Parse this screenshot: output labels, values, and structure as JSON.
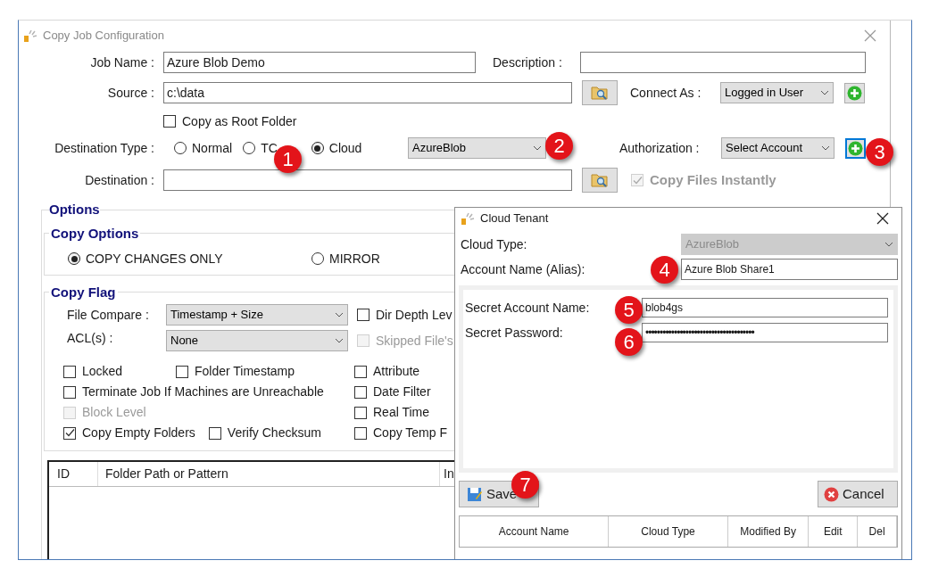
{
  "window": {
    "title": "Copy Job Configuration"
  },
  "job_name": {
    "label": "Job Name :",
    "value": "Azure Blob Demo"
  },
  "description": {
    "label": "Description :"
  },
  "source": {
    "label": "Source :",
    "value": "c:\\data"
  },
  "connect_as": {
    "label": "Connect As :",
    "value": "Logged in User",
    "add_focused": false
  },
  "copy_as_root_folder": {
    "label": "Copy as Root Folder",
    "checked": false,
    "disabled": false
  },
  "destination_type": {
    "label": "Destination Type :",
    "options": [
      {
        "label": "Normal",
        "selected": false
      },
      {
        "label": "TC",
        "selected": false
      },
      {
        "label": "Cloud",
        "selected": true
      }
    ]
  },
  "cloud_provider": {
    "value": "AzureBlob"
  },
  "authorization": {
    "label": "Authorization :",
    "value": "Select Account",
    "add_focused": true
  },
  "destination": {
    "label": "Destination :"
  },
  "copy_files_instantly": {
    "label": "Copy Files Instantly",
    "checked": true,
    "disabled": true
  },
  "options": {
    "title": "Options",
    "copy_options": {
      "title": "Copy Options",
      "choices": [
        {
          "label": "COPY CHANGES ONLY",
          "selected": true
        },
        {
          "label": "MIRROR",
          "selected": false
        }
      ]
    },
    "copy_flag": {
      "title": "Copy Flag",
      "file_compare": {
        "label": "File Compare :",
        "value": "Timestamp + Size"
      },
      "acl": {
        "label": "ACL(s) :",
        "value": "None"
      },
      "side_checks": [
        {
          "label": "Dir Depth Lev",
          "checked": false,
          "disabled": false
        },
        {
          "label": "Skipped File's",
          "checked": false,
          "disabled": true
        }
      ],
      "check_rows": [
        {
          "left": [
            {
              "label": "Locked",
              "checked": false,
              "disabled": false
            },
            {
              "label": "Folder Timestamp",
              "checked": false,
              "disabled": false
            }
          ],
          "right": {
            "label": "Attribute",
            "checked": false,
            "disabled": false
          }
        },
        {
          "left": [
            {
              "label": "Terminate Job If Machines are Unreachable",
              "checked": false,
              "disabled": false
            }
          ],
          "right": {
            "label": "Date Filter",
            "checked": false,
            "disabled": false
          }
        },
        {
          "left": [
            {
              "label": "Block Level",
              "checked": false,
              "disabled": true
            }
          ],
          "right": {
            "label": "Real Time",
            "checked": false,
            "disabled": false
          }
        },
        {
          "left": [
            {
              "label": "Copy Empty Folders",
              "checked": true,
              "disabled": false
            },
            {
              "label": "Verify Checksum",
              "checked": false,
              "disabled": false
            }
          ],
          "right": {
            "label": "Copy Temp F",
            "checked": false,
            "disabled": false
          }
        }
      ]
    }
  },
  "table": {
    "columns": [
      "ID",
      "Folder Path or Pattern",
      "In"
    ]
  },
  "dialog": {
    "title": "Cloud Tenant",
    "cloud_type": {
      "label": "Cloud Type:",
      "value": "AzureBlob",
      "disabled": true
    },
    "account_name": {
      "label": "Account Name (Alias):",
      "value": "Azure Blob Share1"
    },
    "secret_account_name": {
      "label": "Secret Account Name:",
      "value": "blob4gs"
    },
    "secret_password": {
      "label": "Secret Password:",
      "value": "••••••••••••••••••••••••••••••••••••••"
    },
    "save": "Save",
    "cancel": "Cancel",
    "columns": [
      "Account Name",
      "Cloud Type",
      "Modified By",
      "Edit",
      "Del"
    ]
  },
  "callouts": [
    "1",
    "2",
    "3",
    "4",
    "5",
    "6",
    "7"
  ]
}
